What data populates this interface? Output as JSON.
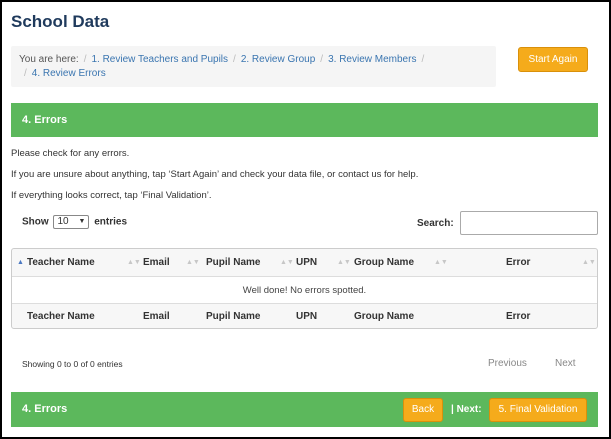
{
  "page": {
    "title": "School Data"
  },
  "breadcrumb": {
    "prefix": "You are here:",
    "separator": "/",
    "items": [
      {
        "label": "1. Review Teachers and Pupils"
      },
      {
        "label": "2. Review Group"
      },
      {
        "label": "3. Review Members"
      },
      {
        "label": "4. Review Errors"
      }
    ]
  },
  "actions": {
    "start_again": "Start Again"
  },
  "section": {
    "title": "4. Errors"
  },
  "instructions": {
    "line1": "Please check for any errors.",
    "line2": "If you are unsure about anything, tap ‘Start Again’ and check your data file, or contact us for help.",
    "line3": "If everything looks correct, tap ‘Final Validation’."
  },
  "table_controls": {
    "show_label": "Show",
    "entries_value": "10",
    "entries_label": "entries",
    "search_label": "Search:",
    "search_value": ""
  },
  "table": {
    "columns": [
      "Teacher Name",
      "Email",
      "Pupil Name",
      "UPN",
      "Group Name",
      "Error"
    ],
    "empty_message": "Well done! No errors spotted.",
    "info": "Showing 0 to 0 of 0 entries"
  },
  "pagination": {
    "previous": "Previous",
    "next": "Next"
  },
  "footer": {
    "title": "4. Errors",
    "back": "Back",
    "next_label": "| Next:",
    "final_validation": "5. Final Validation"
  },
  "colors": {
    "header_green": "#5cb85c",
    "button_orange": "#f5ab1b",
    "title_navy": "#1f3a5c",
    "link_blue": "#3a75b0"
  }
}
